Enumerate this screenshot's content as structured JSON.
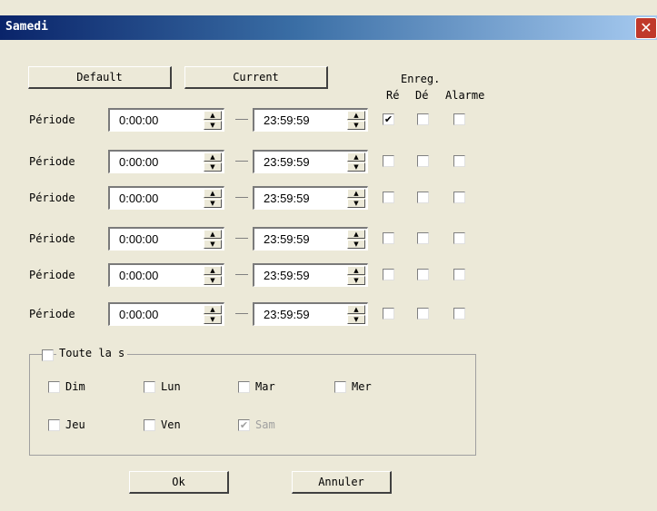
{
  "window": {
    "title": "Samedi",
    "close_glyph": "✕"
  },
  "buttons": {
    "default": "Default",
    "current": "Current",
    "ok": "Ok",
    "cancel": "Annuler"
  },
  "headers": {
    "enreg": "Enreg.",
    "re": "Ré",
    "de": "Dé",
    "alarme": "Alarme"
  },
  "periods": [
    {
      "label": "Période",
      "start": "0:00:00",
      "end": "23:59:59",
      "re": true,
      "de": false,
      "alarme": false
    },
    {
      "label": "Période",
      "start": "0:00:00",
      "end": "23:59:59",
      "re": false,
      "de": false,
      "alarme": false
    },
    {
      "label": "Période",
      "start": "0:00:00",
      "end": "23:59:59",
      "re": false,
      "de": false,
      "alarme": false
    },
    {
      "label": "Période",
      "start": "0:00:00",
      "end": "23:59:59",
      "re": false,
      "de": false,
      "alarme": false
    },
    {
      "label": "Période",
      "start": "0:00:00",
      "end": "23:59:59",
      "re": false,
      "de": false,
      "alarme": false
    },
    {
      "label": "Période",
      "start": "0:00:00",
      "end": "23:59:59",
      "re": false,
      "de": false,
      "alarme": false
    }
  ],
  "week": {
    "label": "Toute la s",
    "checked": false,
    "days": [
      {
        "label": "Dim",
        "checked": false,
        "disabled": false
      },
      {
        "label": "Lun",
        "checked": false,
        "disabled": false
      },
      {
        "label": "Mar",
        "checked": false,
        "disabled": false
      },
      {
        "label": "Mer",
        "checked": false,
        "disabled": false
      },
      {
        "label": "Jeu",
        "checked": false,
        "disabled": false
      },
      {
        "label": "Ven",
        "checked": false,
        "disabled": false
      },
      {
        "label": "Sam",
        "checked": true,
        "disabled": true
      }
    ]
  },
  "icons": {
    "spin_up": "▲",
    "spin_down": "▼",
    "check": "✔"
  }
}
